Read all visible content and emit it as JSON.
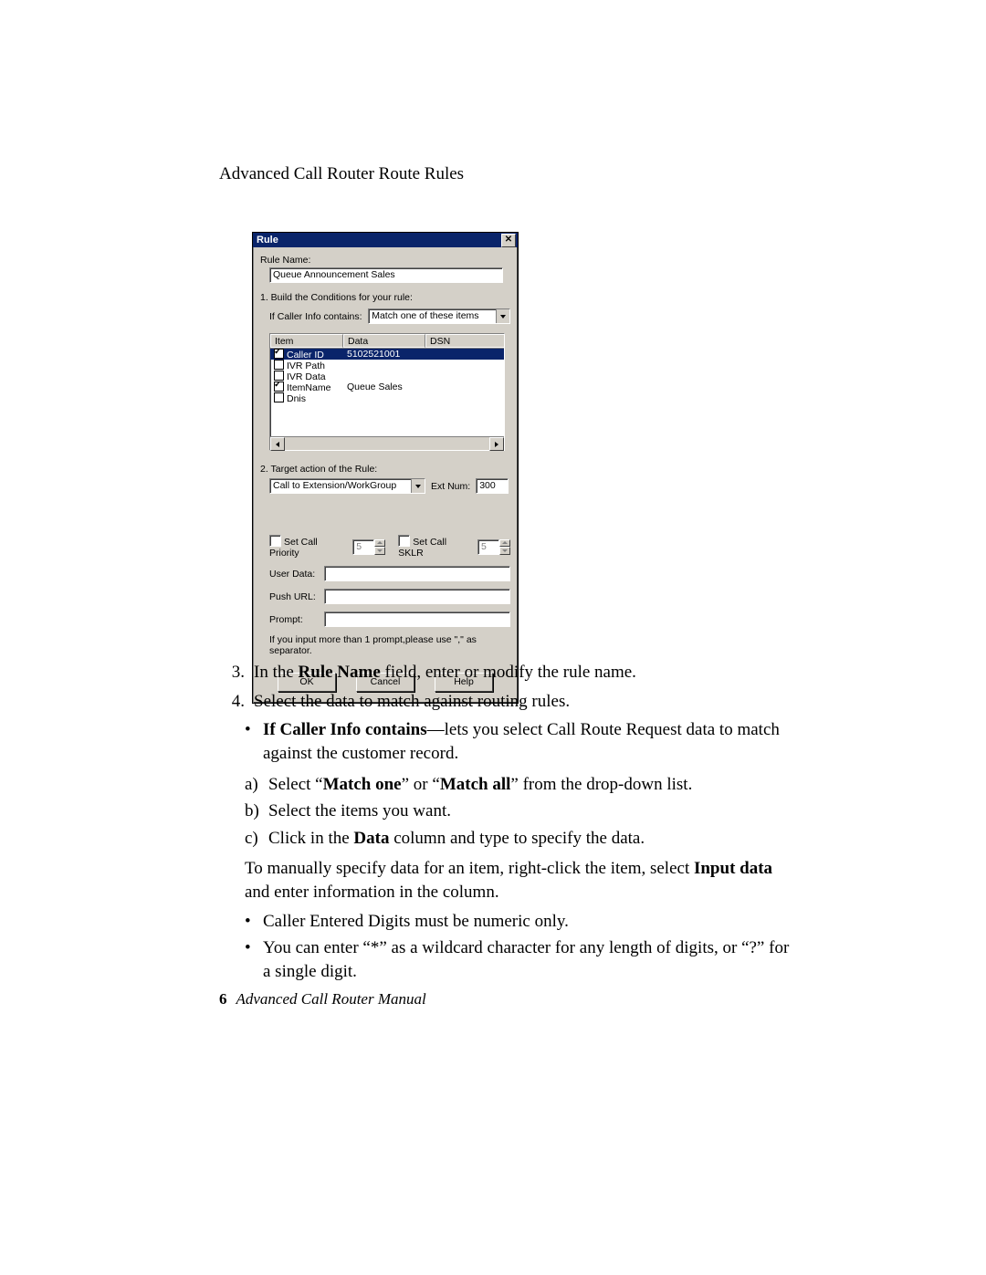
{
  "header": "Advanced Call Router Route Rules",
  "dialog": {
    "title": "Rule",
    "rule_name_label": "Rule Name:",
    "rule_name_value": "Queue Announcement Sales",
    "section1": "1. Build the Conditions for your rule:",
    "if_caller_label": "If Caller Info contains:",
    "match_dropdown": "Match one of these items",
    "columns": {
      "item": "Item",
      "data": "Data",
      "dsn": "DSN"
    },
    "rows": [
      {
        "checked": true,
        "item": "Caller ID",
        "data": "5102521001",
        "dsn": "",
        "selected": true
      },
      {
        "checked": false,
        "item": "IVR Path",
        "data": "",
        "dsn": "",
        "selected": false
      },
      {
        "checked": false,
        "item": "IVR Data",
        "data": "",
        "dsn": "",
        "selected": false
      },
      {
        "checked": true,
        "item": "ItemName",
        "data": "Queue Sales",
        "dsn": "",
        "selected": false
      },
      {
        "checked": false,
        "item": "Dnis",
        "data": "",
        "dsn": "",
        "selected": false
      }
    ],
    "section2": "2. Target action of the Rule:",
    "target_dropdown": "Call to Extension/WorkGroup",
    "extnum_label": "Ext Num:",
    "extnum_value": "300",
    "set_priority_label": "Set Call Priority",
    "set_priority_value": "5",
    "set_sklr_label": "Set Call SKLR",
    "set_sklr_value": "5",
    "user_data_label": "User Data:",
    "push_url_label": "Push URL:",
    "prompt_label": "Prompt:",
    "hint": "If you input more than 1 prompt,please use \",\" as separator.",
    "ok": "OK",
    "cancel": "Cancel",
    "help": "Help"
  },
  "body": {
    "step3_num": "3.",
    "step3_a": "In the ",
    "step3_b": "Rule Name",
    "step3_c": " field, enter or modify the rule name.",
    "step4_num": "4.",
    "step4": "Select the data to match against routing rules.",
    "bullet_a1": "If Caller Info contains",
    "bullet_a2": "—lets you select Call Route Request data to match against the customer record.",
    "sa_let": "a)",
    "sa_1": "Select “",
    "sa_2": "Match one",
    "sa_3": "” or “",
    "sa_4": "Match all",
    "sa_5": "” from the drop-down list.",
    "sb_let": "b)",
    "sb": "Select the items you want.",
    "sc_let": "c)",
    "sc_1": "Click in the ",
    "sc_2": "Data",
    "sc_3": " column and type to specify the data.",
    "para1_a": "To manually specify data for an item, right-click the item, select ",
    "para1_b": "Input data",
    "para1_c": " and enter information in the column.",
    "ib1": "Caller Entered Digits must be numeric only.",
    "ib2": "You can enter “*” as a wildcard character for any length of digits, or “?” for a single digit."
  },
  "footer": {
    "page": "6",
    "title": "Advanced Call Router Manual"
  }
}
